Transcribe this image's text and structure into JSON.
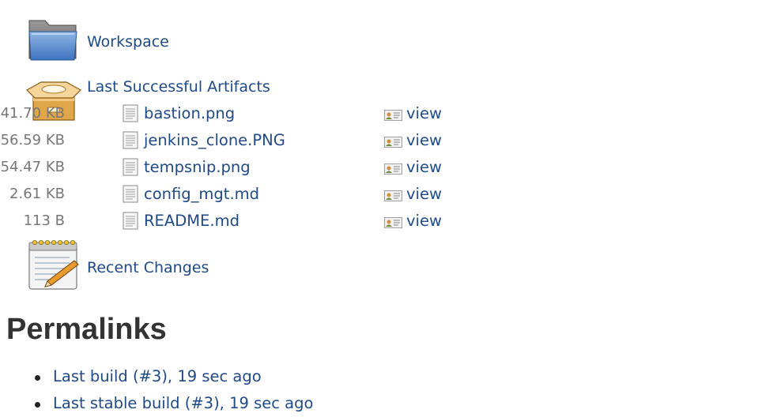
{
  "sections": {
    "workspace_label": "Workspace",
    "artifacts_label": "Last Successful Artifacts",
    "recent_changes_label": "Recent Changes"
  },
  "artifacts": [
    {
      "name": "bastion.png",
      "size": "41.70 KB",
      "view": "view"
    },
    {
      "name": "jenkins_clone.PNG",
      "size": "56.59 KB",
      "view": "view"
    },
    {
      "name": "tempsnip.png",
      "size": "54.47 KB",
      "view": "view"
    },
    {
      "name": "config_mgt.md",
      "size": "2.61 KB",
      "view": "view"
    },
    {
      "name": "README.md",
      "size": "113 B",
      "view": "view"
    }
  ],
  "permalinks": {
    "title": "Permalinks",
    "items": [
      {
        "label": "Last build (#3), 19 sec ago"
      },
      {
        "label": "Last stable build (#3), 19 sec ago"
      }
    ]
  },
  "icons": {
    "workspace": "folder-icon",
    "artifacts": "package-box-icon",
    "recent_changes": "notepad-pencil-icon",
    "file": "document-icon",
    "view": "view-card-icon"
  }
}
